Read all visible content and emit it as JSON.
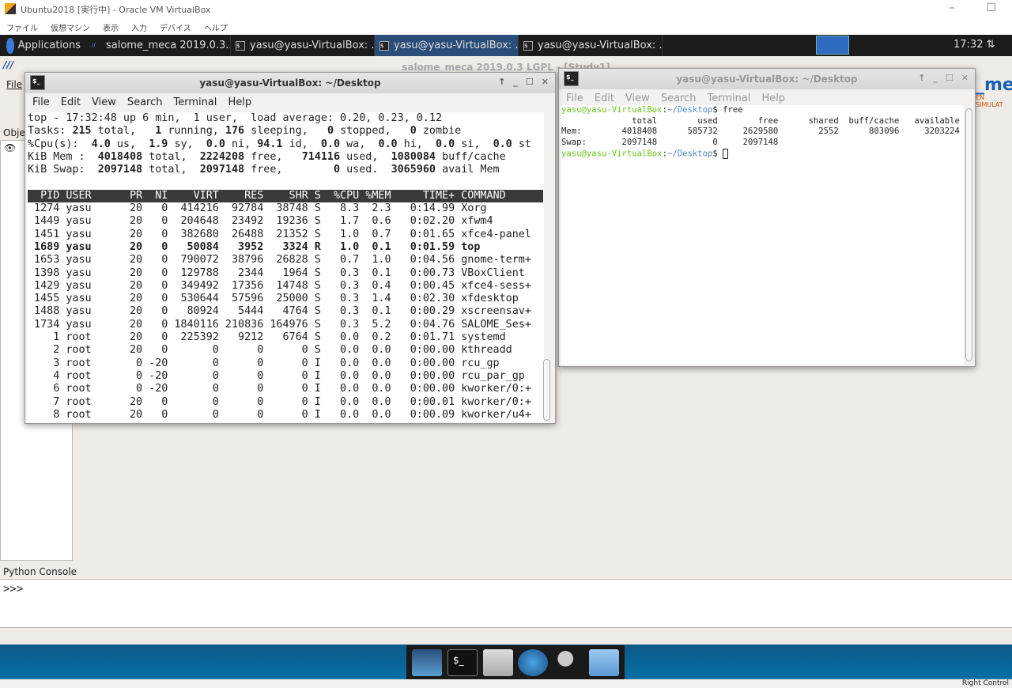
{
  "host": {
    "title": "Ubuntu2018 [実行中] - Oracle VM VirtualBox",
    "menu": [
      "ファイル",
      "仮想マシン",
      "表示",
      "入力",
      "デバイス",
      "ヘルプ"
    ],
    "status_label": "Right Control"
  },
  "panel": {
    "applications": "Applications",
    "tasks": [
      {
        "label": "salome_meca 2019.0.3...",
        "active": false
      },
      {
        "label": "yasu@yasu-VirtualBox: ...",
        "active": false
      },
      {
        "label": "yasu@yasu-VirtualBox: ...",
        "active": true
      },
      {
        "label": "yasu@yasu-VirtualBox: ...",
        "active": false
      }
    ],
    "clock": "17:32"
  },
  "salome": {
    "title": "salome_meca 2019.0.3 LGPL - [Study1]",
    "menu_file": "File",
    "object_browser": "Obje",
    "logo": "_mec",
    "logo_sub": "EN SIMULAT",
    "python_console_label": "Python Console",
    "python_prompt": ">>>"
  },
  "top_terminal": {
    "title": "yasu@yasu-VirtualBox: ~/Desktop",
    "menu": [
      "File",
      "Edit",
      "View",
      "Search",
      "Terminal",
      "Help"
    ],
    "summary": [
      "top - 17:32:48 up 6 min,  1 user,  load average: 0.20, 0.23, 0.12",
      "Tasks: 215 total,   1 running, 176 sleeping,   0 stopped,   0 zombie",
      "%Cpu(s):  4.0 us,  1.9 sy,  0.0 ni, 94.1 id,  0.0 wa,  0.0 hi,  0.0 si,  0.0 st",
      "KiB Mem :  4018408 total,  2224208 free,   714116 used,  1080084 buff/cache",
      "KiB Swap:  2097148 total,  2097148 free,        0 used.  3065960 avail Mem"
    ],
    "columns": [
      "PID",
      "USER",
      "PR",
      "NI",
      "VIRT",
      "RES",
      "SHR",
      "S",
      "%CPU",
      "%MEM",
      "TIME+",
      "COMMAND"
    ],
    "rows": [
      [
        "1274",
        "yasu",
        "20",
        "0",
        "414216",
        "92784",
        "38748",
        "S",
        "8.3",
        "2.3",
        "0:14.99",
        "Xorg"
      ],
      [
        "1449",
        "yasu",
        "20",
        "0",
        "204648",
        "23492",
        "19236",
        "S",
        "1.7",
        "0.6",
        "0:02.20",
        "xfwm4"
      ],
      [
        "1451",
        "yasu",
        "20",
        "0",
        "382680",
        "26488",
        "21352",
        "S",
        "1.0",
        "0.7",
        "0:01.65",
        "xfce4-panel"
      ],
      [
        "1689",
        "yasu",
        "20",
        "0",
        "50084",
        "3952",
        "3324",
        "R",
        "1.0",
        "0.1",
        "0:01.59",
        "top"
      ],
      [
        "1653",
        "yasu",
        "20",
        "0",
        "790072",
        "38796",
        "26828",
        "S",
        "0.7",
        "1.0",
        "0:04.56",
        "gnome-term+"
      ],
      [
        "1398",
        "yasu",
        "20",
        "0",
        "129788",
        "2344",
        "1964",
        "S",
        "0.3",
        "0.1",
        "0:00.73",
        "VBoxClient"
      ],
      [
        "1429",
        "yasu",
        "20",
        "0",
        "349492",
        "17356",
        "14748",
        "S",
        "0.3",
        "0.4",
        "0:00.45",
        "xfce4-sess+"
      ],
      [
        "1455",
        "yasu",
        "20",
        "0",
        "530644",
        "57596",
        "25000",
        "S",
        "0.3",
        "1.4",
        "0:02.30",
        "xfdesktop"
      ],
      [
        "1488",
        "yasu",
        "20",
        "0",
        "80924",
        "5444",
        "4764",
        "S",
        "0.3",
        "0.1",
        "0:00.29",
        "xscreensav+"
      ],
      [
        "1734",
        "yasu",
        "20",
        "0",
        "1840116",
        "210836",
        "164976",
        "S",
        "0.3",
        "5.2",
        "0:04.76",
        "SALOME_Ses+"
      ],
      [
        "1",
        "root",
        "20",
        "0",
        "225392",
        "9212",
        "6764",
        "S",
        "0.0",
        "0.2",
        "0:01.71",
        "systemd"
      ],
      [
        "2",
        "root",
        "20",
        "0",
        "0",
        "0",
        "0",
        "S",
        "0.0",
        "0.0",
        "0:00.00",
        "kthreadd"
      ],
      [
        "3",
        "root",
        "0",
        "-20",
        "0",
        "0",
        "0",
        "I",
        "0.0",
        "0.0",
        "0:00.00",
        "rcu_gp"
      ],
      [
        "4",
        "root",
        "0",
        "-20",
        "0",
        "0",
        "0",
        "I",
        "0.0",
        "0.0",
        "0:00.00",
        "rcu_par_gp"
      ],
      [
        "6",
        "root",
        "0",
        "-20",
        "0",
        "0",
        "0",
        "I",
        "0.0",
        "0.0",
        "0:00.00",
        "kworker/0:+"
      ],
      [
        "7",
        "root",
        "20",
        "0",
        "0",
        "0",
        "0",
        "I",
        "0.0",
        "0.0",
        "0:00.01",
        "kworker/0:+"
      ],
      [
        "8",
        "root",
        "20",
        "0",
        "0",
        "0",
        "0",
        "I",
        "0.0",
        "0.0",
        "0:00.09",
        "kworker/u4+"
      ]
    ],
    "bold_row_pid": "1689"
  },
  "free_terminal": {
    "title": "yasu@yasu-VirtualBox: ~/Desktop",
    "menu": [
      "File",
      "Edit",
      "View",
      "Search",
      "Terminal",
      "Help"
    ],
    "prompt_user": "yasu@yasu-VirtualBox",
    "prompt_path": "~/Desktop",
    "command": "free",
    "columns": [
      "total",
      "used",
      "free",
      "shared",
      "buff/cache",
      "available"
    ],
    "rows": [
      [
        "Mem:",
        "4018408",
        "585732",
        "2629580",
        "2552",
        "803096",
        "3203224"
      ],
      [
        "Swap:",
        "2097148",
        "0",
        "2097148"
      ]
    ]
  },
  "dock": [
    "desktop",
    "terminal",
    "home-folder",
    "web-browser",
    "search",
    "files"
  ]
}
